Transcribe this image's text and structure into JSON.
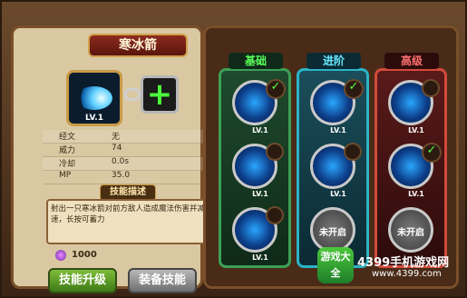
{
  "window": {
    "title": "寒冰箭"
  },
  "skill": {
    "level": "LV.1",
    "stats": [
      {
        "label": "经文",
        "value": "无"
      },
      {
        "label": "威力",
        "value": "74"
      },
      {
        "label": "冷却",
        "value": "0.0s"
      },
      {
        "label": "MP",
        "value": "35.0"
      }
    ],
    "desc_title": "技能描述",
    "description": "射出一只寒冰箭对前方敌人造成魔法伤害并减速，长按可蓄力",
    "currency": "1000"
  },
  "buttons": {
    "upgrade": "技能升级",
    "equip": "装备技能"
  },
  "tree": {
    "tabs": [
      "基础",
      "进阶",
      "高级"
    ],
    "basic": [
      {
        "level": "LV.1",
        "checked": true
      },
      {
        "level": "LV.1",
        "checked": false
      },
      {
        "level": "LV.1",
        "checked": false
      }
    ],
    "advanced": [
      {
        "level": "LV.1",
        "checked": true
      },
      {
        "level": "LV.1",
        "checked": false
      },
      {
        "locked": "未开启"
      }
    ],
    "high": [
      {
        "level": "LV.1",
        "checked": false
      },
      {
        "level": "LV.1",
        "checked": true
      },
      {
        "locked": "未开启"
      }
    ]
  },
  "watermark": {
    "logo": "游戏大全",
    "site": "4399手机游戏网",
    "url": "www.4399.com"
  },
  "colors": {
    "accent_green": "#3ca056",
    "accent_teal": "#2bb3c5",
    "accent_red": "#d24a3a"
  }
}
